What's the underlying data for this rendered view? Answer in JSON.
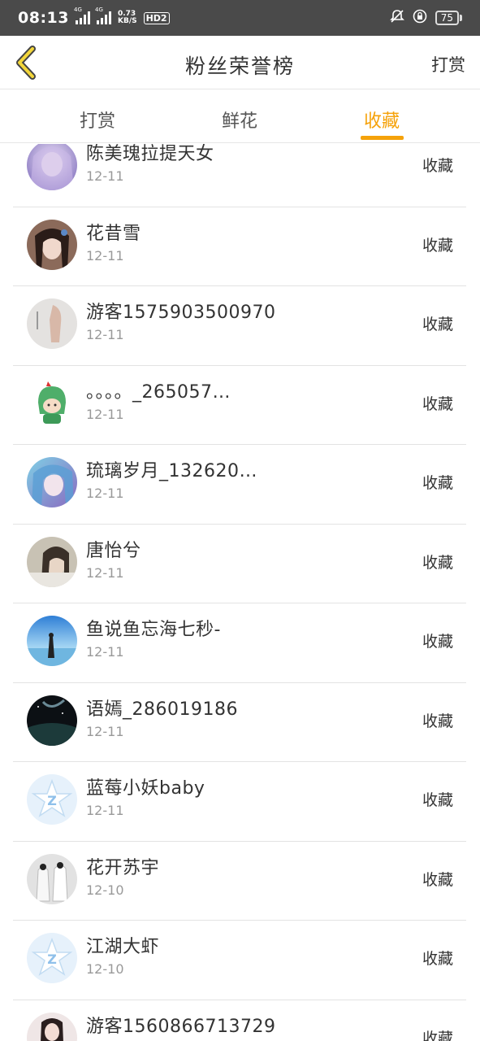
{
  "status_bar": {
    "time": "08:13",
    "sim1": "4G",
    "sim2": "4G",
    "speed_value": "0.73",
    "speed_unit": "KB/S",
    "hd": "HD2",
    "battery": "75"
  },
  "header": {
    "title": "粉丝荣誉榜",
    "action": "打赏"
  },
  "tabs": [
    {
      "label": "打赏",
      "active": false
    },
    {
      "label": "鲜花",
      "active": false
    },
    {
      "label": "收藏",
      "active": true
    }
  ],
  "accent_color": "#f5a20a",
  "list": [
    {
      "name": "陈美瑰拉提天女",
      "date": "12-11",
      "action": "收藏",
      "avatar": "anime-girl-purple"
    },
    {
      "name": "花昔雪",
      "date": "12-11",
      "action": "收藏",
      "avatar": "ancient-costume-girl"
    },
    {
      "name": "游客1575903500970",
      "date": "12-11",
      "action": "收藏",
      "avatar": "photo-hand"
    },
    {
      "name": "。。。。_265057…",
      "date": "12-11",
      "action": "收藏",
      "avatar": "green-dino-cartoon"
    },
    {
      "name": "琉璃岁月_132620…",
      "date": "12-11",
      "action": "收藏",
      "avatar": "anime-girl-blue"
    },
    {
      "name": "唐怡兮",
      "date": "12-11",
      "action": "收藏",
      "avatar": "girl-portrait"
    },
    {
      "name": "鱼说鱼忘海七秒-",
      "date": "12-11",
      "action": "收藏",
      "avatar": "seaside-sky"
    },
    {
      "name": "语嫣_286019186",
      "date": "12-11",
      "action": "收藏",
      "avatar": "night-sky"
    },
    {
      "name": "蓝莓小妖baby",
      "date": "12-11",
      "action": "收藏",
      "avatar": "default-qq-icon"
    },
    {
      "name": "花开苏宇",
      "date": "12-10",
      "action": "收藏",
      "avatar": "two-figures-white"
    },
    {
      "name": "江湖大虾",
      "date": "12-10",
      "action": "收藏",
      "avatar": "default-qq-icon"
    },
    {
      "name": "游客1560866713729",
      "date": "",
      "action": "收藏",
      "avatar": "girl-photo"
    }
  ]
}
